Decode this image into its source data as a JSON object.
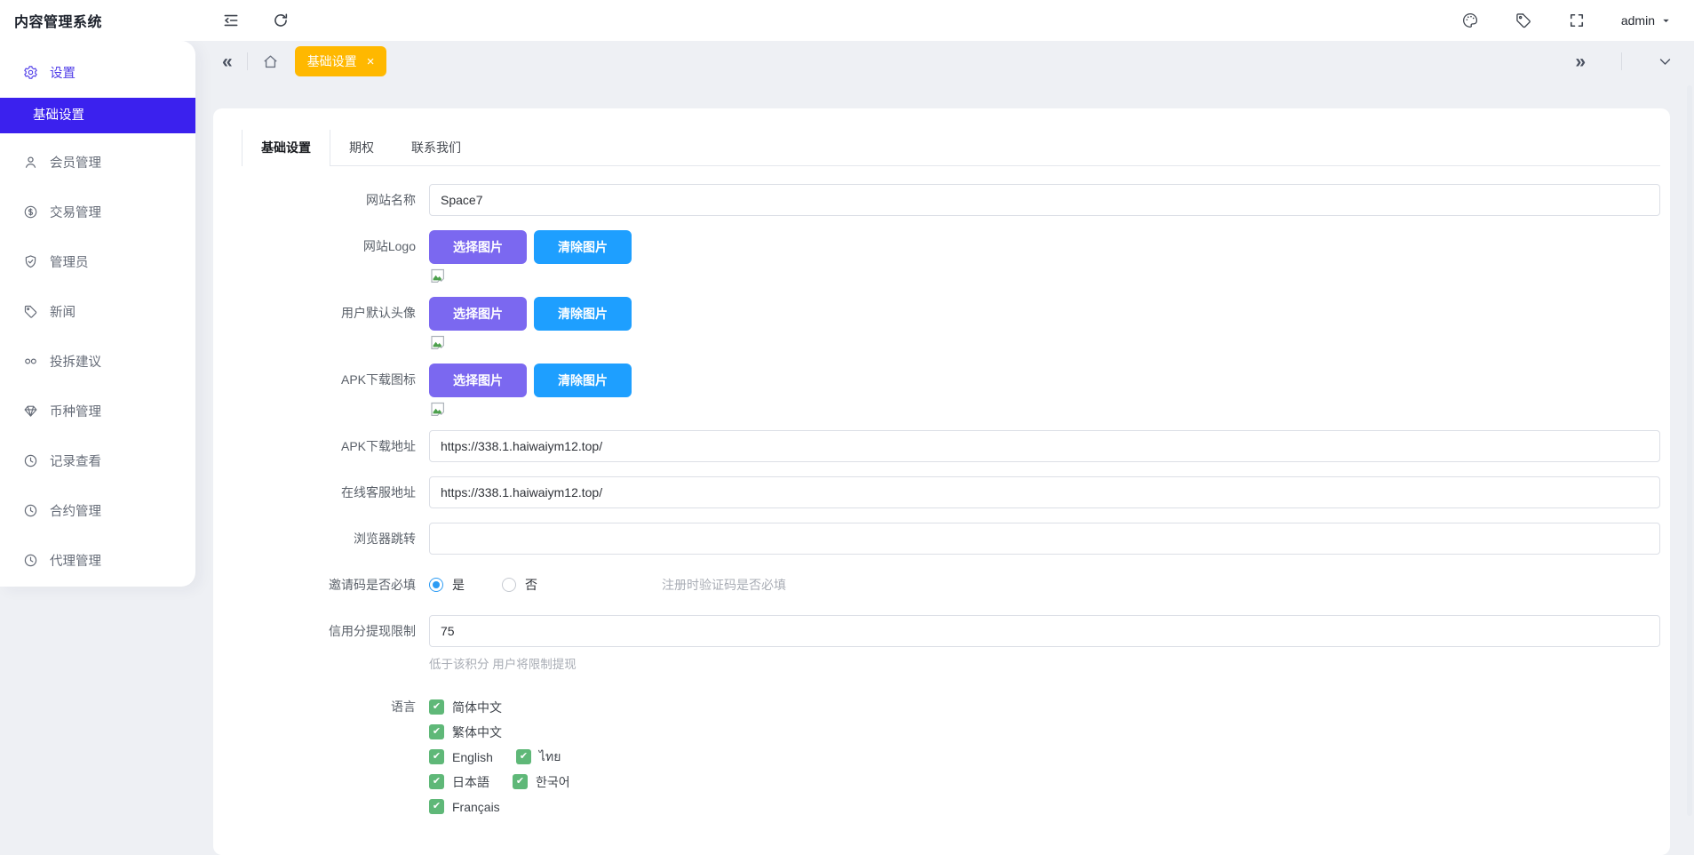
{
  "colors": {
    "page-bg": "#eef0f4",
    "surface": "#ffffff",
    "primary": "#3b21ee",
    "primary-text": "#4f3ce8",
    "menu-text": "#666c78",
    "yellow": "#ffb800",
    "purple": "#7b68f0",
    "blue": "#1e9fff",
    "green": "#5fb878",
    "radio-blue": "#2d9cf4",
    "input-border": "#dcdfe6",
    "tab-border": "#e4e7ed",
    "hint": "#a9adb5",
    "label": "#5a6069"
  },
  "header": {
    "title": "内容管理系统",
    "left_icons": [
      "menu-fold-icon",
      "refresh-icon"
    ],
    "right_icons": [
      "palette-icon",
      "tag-icon",
      "fullscreen-icon"
    ],
    "user": "admin"
  },
  "tags_bar": {
    "left_icons": [
      "collapse-left-icon",
      "home-icon"
    ],
    "active_tag": {
      "label": "基础设置",
      "closable": true
    },
    "right_icons": [
      "collapse-right-icon",
      "chevron-down-icon"
    ]
  },
  "sidebar": {
    "items": [
      {
        "id": "settings",
        "label": "设置",
        "icon": "gear-icon",
        "active": true,
        "children": [
          {
            "id": "basic-settings",
            "label": "基础设置",
            "active": true
          }
        ]
      },
      {
        "id": "members",
        "label": "会员管理",
        "icon": "user-icon"
      },
      {
        "id": "trades",
        "label": "交易管理",
        "icon": "dollar-icon"
      },
      {
        "id": "admins",
        "label": "管理员",
        "icon": "shield-icon"
      },
      {
        "id": "news",
        "label": "新闻",
        "icon": "tag-icon"
      },
      {
        "id": "feedback",
        "label": "投拆建议",
        "icon": "infinity-icon"
      },
      {
        "id": "currencies",
        "label": "币种管理",
        "icon": "diamond-icon"
      },
      {
        "id": "records",
        "label": "记录查看",
        "icon": "compass-icon"
      },
      {
        "id": "contracts",
        "label": "合约管理",
        "icon": "compass-icon"
      },
      {
        "id": "agents",
        "label": "代理管理",
        "icon": "compass-icon"
      }
    ]
  },
  "tabs": [
    {
      "id": "basic",
      "label": "基础设置",
      "active": true
    },
    {
      "id": "options",
      "label": "期权",
      "active": false
    },
    {
      "id": "contact",
      "label": "联系我们",
      "active": false
    }
  ],
  "form": {
    "site_name": {
      "label": "网站名称",
      "value": "Space7"
    },
    "uploads": [
      {
        "id": "site-logo",
        "label": "网站Logo",
        "select_label": "选择图片",
        "clear_label": "清除图片",
        "preview_icon": "broken-image-icon"
      },
      {
        "id": "default-avatar",
        "label": "用户默认头像",
        "select_label": "选择图片",
        "clear_label": "清除图片",
        "preview_icon": "broken-image-icon"
      },
      {
        "id": "apk-icon",
        "label": "APK下载图标",
        "select_label": "选择图片",
        "clear_label": "清除图片",
        "preview_icon": "broken-image-icon"
      }
    ],
    "apk_url": {
      "label": "APK下载地址",
      "value": "https://338.1.haiwaiym12.top/"
    },
    "service_url": {
      "label": "在线客服地址",
      "value": "https://338.1.haiwaiym12.top/"
    },
    "browser_redirect": {
      "label": "浏览器跳转",
      "value": ""
    },
    "invite_required": {
      "label": "邀请码是否必填",
      "options": [
        {
          "label": "是",
          "selected": true
        },
        {
          "label": "否",
          "selected": false
        }
      ],
      "hint": "注册时验证码是否必填"
    },
    "credit_limit": {
      "label": "信用分提现限制",
      "value": "75",
      "hint": "低于该积分 用户将限制提现"
    },
    "languages": {
      "label": "语言",
      "rows": [
        [
          {
            "label": "简体中文",
            "checked": true
          }
        ],
        [
          {
            "label": "繁体中文",
            "checked": true
          }
        ],
        [
          {
            "label": "English",
            "checked": true
          },
          {
            "label": "ไทย",
            "checked": true
          }
        ],
        [
          {
            "label": "日本語",
            "checked": true
          },
          {
            "label": "한국어",
            "checked": true
          }
        ],
        [
          {
            "label": "Français",
            "checked": true
          }
        ]
      ]
    }
  }
}
